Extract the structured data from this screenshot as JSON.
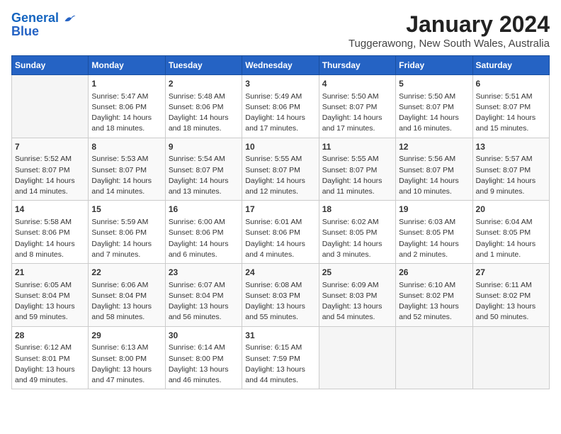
{
  "header": {
    "logo_line1": "General",
    "logo_line2": "Blue",
    "title": "January 2024",
    "subtitle": "Tuggerawong, New South Wales, Australia"
  },
  "weekdays": [
    "Sunday",
    "Monday",
    "Tuesday",
    "Wednesday",
    "Thursday",
    "Friday",
    "Saturday"
  ],
  "weeks": [
    [
      {
        "num": "",
        "info": ""
      },
      {
        "num": "1",
        "info": "Sunrise: 5:47 AM\nSunset: 8:06 PM\nDaylight: 14 hours\nand 18 minutes."
      },
      {
        "num": "2",
        "info": "Sunrise: 5:48 AM\nSunset: 8:06 PM\nDaylight: 14 hours\nand 18 minutes."
      },
      {
        "num": "3",
        "info": "Sunrise: 5:49 AM\nSunset: 8:06 PM\nDaylight: 14 hours\nand 17 minutes."
      },
      {
        "num": "4",
        "info": "Sunrise: 5:50 AM\nSunset: 8:07 PM\nDaylight: 14 hours\nand 17 minutes."
      },
      {
        "num": "5",
        "info": "Sunrise: 5:50 AM\nSunset: 8:07 PM\nDaylight: 14 hours\nand 16 minutes."
      },
      {
        "num": "6",
        "info": "Sunrise: 5:51 AM\nSunset: 8:07 PM\nDaylight: 14 hours\nand 15 minutes."
      }
    ],
    [
      {
        "num": "7",
        "info": "Sunrise: 5:52 AM\nSunset: 8:07 PM\nDaylight: 14 hours\nand 14 minutes."
      },
      {
        "num": "8",
        "info": "Sunrise: 5:53 AM\nSunset: 8:07 PM\nDaylight: 14 hours\nand 14 minutes."
      },
      {
        "num": "9",
        "info": "Sunrise: 5:54 AM\nSunset: 8:07 PM\nDaylight: 14 hours\nand 13 minutes."
      },
      {
        "num": "10",
        "info": "Sunrise: 5:55 AM\nSunset: 8:07 PM\nDaylight: 14 hours\nand 12 minutes."
      },
      {
        "num": "11",
        "info": "Sunrise: 5:55 AM\nSunset: 8:07 PM\nDaylight: 14 hours\nand 11 minutes."
      },
      {
        "num": "12",
        "info": "Sunrise: 5:56 AM\nSunset: 8:07 PM\nDaylight: 14 hours\nand 10 minutes."
      },
      {
        "num": "13",
        "info": "Sunrise: 5:57 AM\nSunset: 8:07 PM\nDaylight: 14 hours\nand 9 minutes."
      }
    ],
    [
      {
        "num": "14",
        "info": "Sunrise: 5:58 AM\nSunset: 8:06 PM\nDaylight: 14 hours\nand 8 minutes."
      },
      {
        "num": "15",
        "info": "Sunrise: 5:59 AM\nSunset: 8:06 PM\nDaylight: 14 hours\nand 7 minutes."
      },
      {
        "num": "16",
        "info": "Sunrise: 6:00 AM\nSunset: 8:06 PM\nDaylight: 14 hours\nand 6 minutes."
      },
      {
        "num": "17",
        "info": "Sunrise: 6:01 AM\nSunset: 8:06 PM\nDaylight: 14 hours\nand 4 minutes."
      },
      {
        "num": "18",
        "info": "Sunrise: 6:02 AM\nSunset: 8:05 PM\nDaylight: 14 hours\nand 3 minutes."
      },
      {
        "num": "19",
        "info": "Sunrise: 6:03 AM\nSunset: 8:05 PM\nDaylight: 14 hours\nand 2 minutes."
      },
      {
        "num": "20",
        "info": "Sunrise: 6:04 AM\nSunset: 8:05 PM\nDaylight: 14 hours\nand 1 minute."
      }
    ],
    [
      {
        "num": "21",
        "info": "Sunrise: 6:05 AM\nSunset: 8:04 PM\nDaylight: 13 hours\nand 59 minutes."
      },
      {
        "num": "22",
        "info": "Sunrise: 6:06 AM\nSunset: 8:04 PM\nDaylight: 13 hours\nand 58 minutes."
      },
      {
        "num": "23",
        "info": "Sunrise: 6:07 AM\nSunset: 8:04 PM\nDaylight: 13 hours\nand 56 minutes."
      },
      {
        "num": "24",
        "info": "Sunrise: 6:08 AM\nSunset: 8:03 PM\nDaylight: 13 hours\nand 55 minutes."
      },
      {
        "num": "25",
        "info": "Sunrise: 6:09 AM\nSunset: 8:03 PM\nDaylight: 13 hours\nand 54 minutes."
      },
      {
        "num": "26",
        "info": "Sunrise: 6:10 AM\nSunset: 8:02 PM\nDaylight: 13 hours\nand 52 minutes."
      },
      {
        "num": "27",
        "info": "Sunrise: 6:11 AM\nSunset: 8:02 PM\nDaylight: 13 hours\nand 50 minutes."
      }
    ],
    [
      {
        "num": "28",
        "info": "Sunrise: 6:12 AM\nSunset: 8:01 PM\nDaylight: 13 hours\nand 49 minutes."
      },
      {
        "num": "29",
        "info": "Sunrise: 6:13 AM\nSunset: 8:00 PM\nDaylight: 13 hours\nand 47 minutes."
      },
      {
        "num": "30",
        "info": "Sunrise: 6:14 AM\nSunset: 8:00 PM\nDaylight: 13 hours\nand 46 minutes."
      },
      {
        "num": "31",
        "info": "Sunrise: 6:15 AM\nSunset: 7:59 PM\nDaylight: 13 hours\nand 44 minutes."
      },
      {
        "num": "",
        "info": ""
      },
      {
        "num": "",
        "info": ""
      },
      {
        "num": "",
        "info": ""
      }
    ]
  ]
}
